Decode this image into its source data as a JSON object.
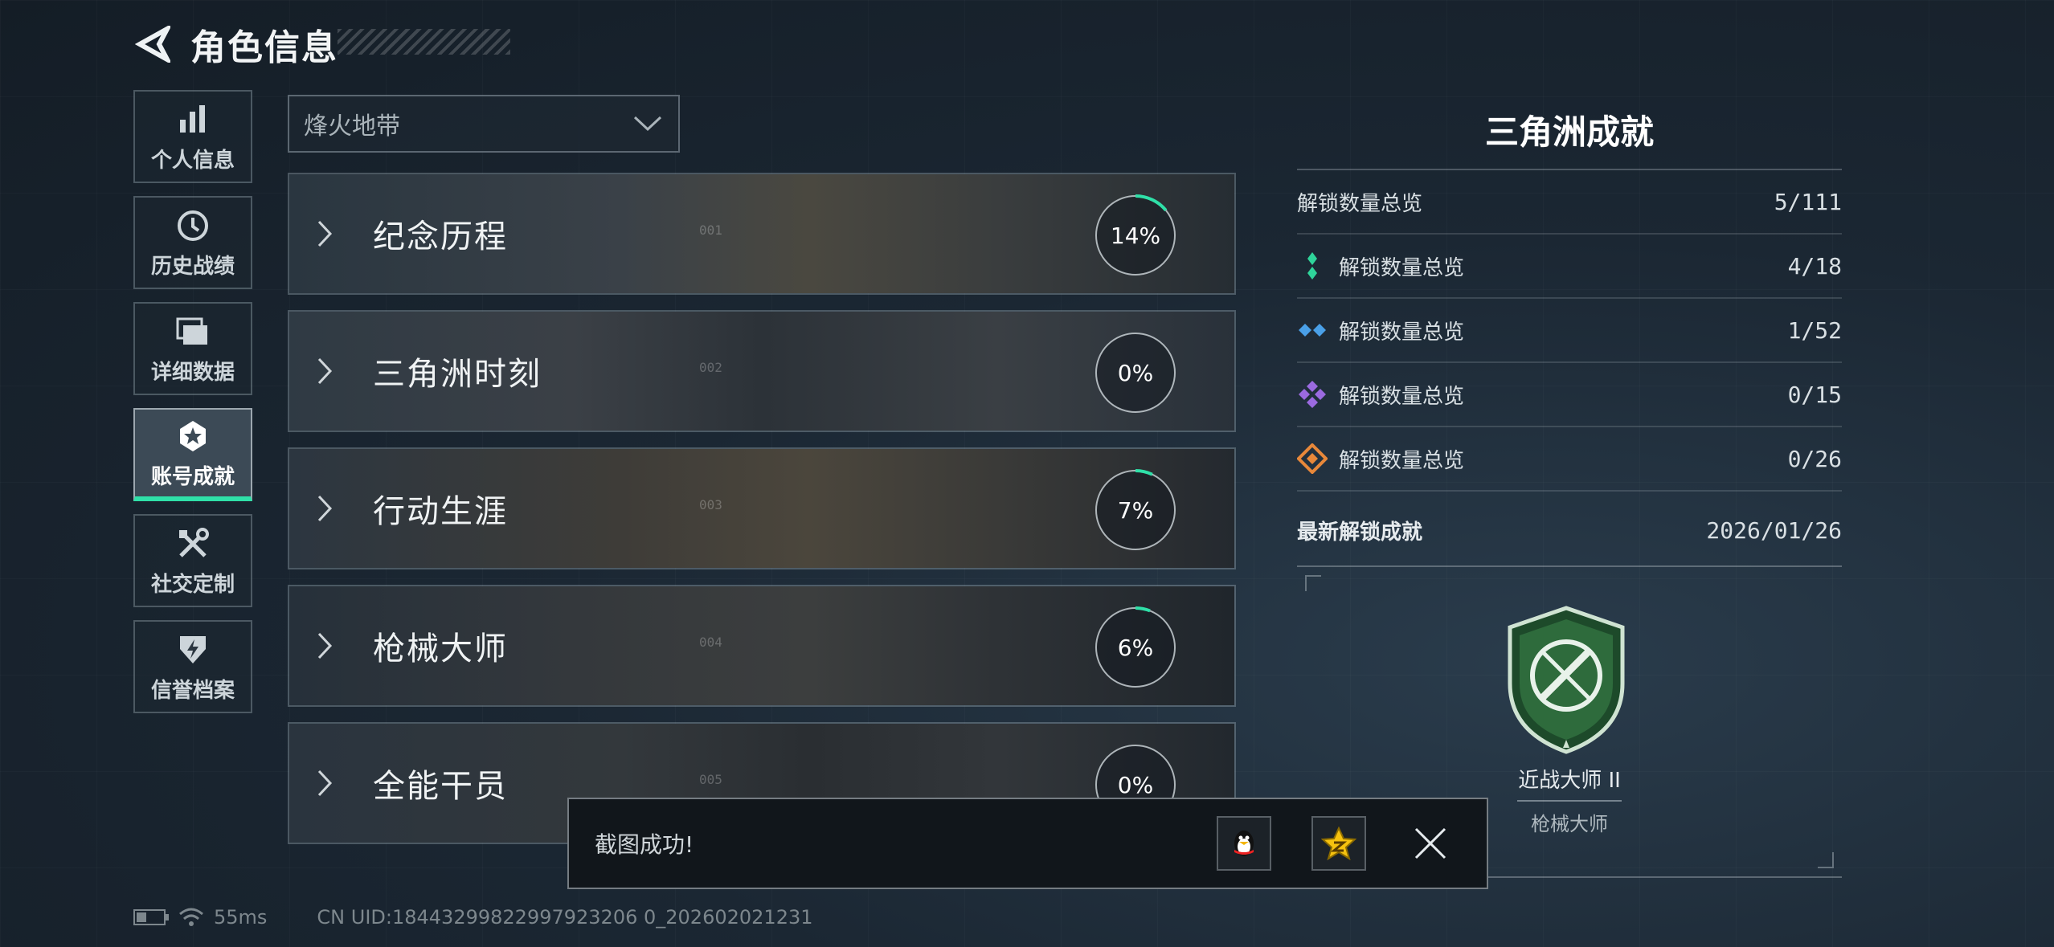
{
  "header": {
    "title": "角色信息"
  },
  "sidebar": {
    "items": [
      {
        "label": "个人信息",
        "icon": "bar-chart-icon",
        "active": false
      },
      {
        "label": "历史战绩",
        "icon": "history-clock-icon",
        "active": false
      },
      {
        "label": "详细数据",
        "icon": "folders-icon",
        "active": false
      },
      {
        "label": "账号成就",
        "icon": "medal-icon",
        "active": true
      },
      {
        "label": "社交定制",
        "icon": "tools-icon",
        "active": false
      },
      {
        "label": "信誉档案",
        "icon": "shield-bolt-icon",
        "active": false
      }
    ]
  },
  "dropdown": {
    "value": "烽火地带"
  },
  "categories": [
    {
      "name": "纪念历程",
      "percent": "14%",
      "progress": 0.14,
      "index": "001"
    },
    {
      "name": "三角洲时刻",
      "percent": "0%",
      "progress": 0,
      "index": "002"
    },
    {
      "name": "行动生涯",
      "percent": "7%",
      "progress": 0.07,
      "index": "003"
    },
    {
      "name": "枪械大师",
      "percent": "6%",
      "progress": 0.06,
      "index": "004"
    },
    {
      "name": "全能干员",
      "percent": "0%",
      "progress": 0,
      "index": "005"
    }
  ],
  "summary": {
    "title": "三角洲成就",
    "total": {
      "label": "解锁数量总览",
      "value": "5/111"
    },
    "rows": [
      {
        "label": "解锁数量总览",
        "value": "4/18",
        "gem": "green-gem-icon",
        "color": "#2fd49a"
      },
      {
        "label": "解锁数量总览",
        "value": "1/52",
        "gem": "blue-gem-icon",
        "color": "#4aa0e8"
      },
      {
        "label": "解锁数量总览",
        "value": "0/15",
        "gem": "purple-gem-icon",
        "color": "#9b6ae0"
      },
      {
        "label": "解锁数量总览",
        "value": "0/26",
        "gem": "orange-gem-icon",
        "color": "#e8883a"
      }
    ],
    "latest": {
      "label": "最新解锁成就",
      "date": "2026/01/26"
    },
    "achievement": {
      "name": "近战大师 II",
      "category": "枪械大师"
    }
  },
  "toast": {
    "message": "截图成功!"
  },
  "status": {
    "ping": "55ms",
    "uid": "CN UID:18443299822997923206 0_202602021231"
  },
  "colors": {
    "accent": "#2fe0a8"
  }
}
